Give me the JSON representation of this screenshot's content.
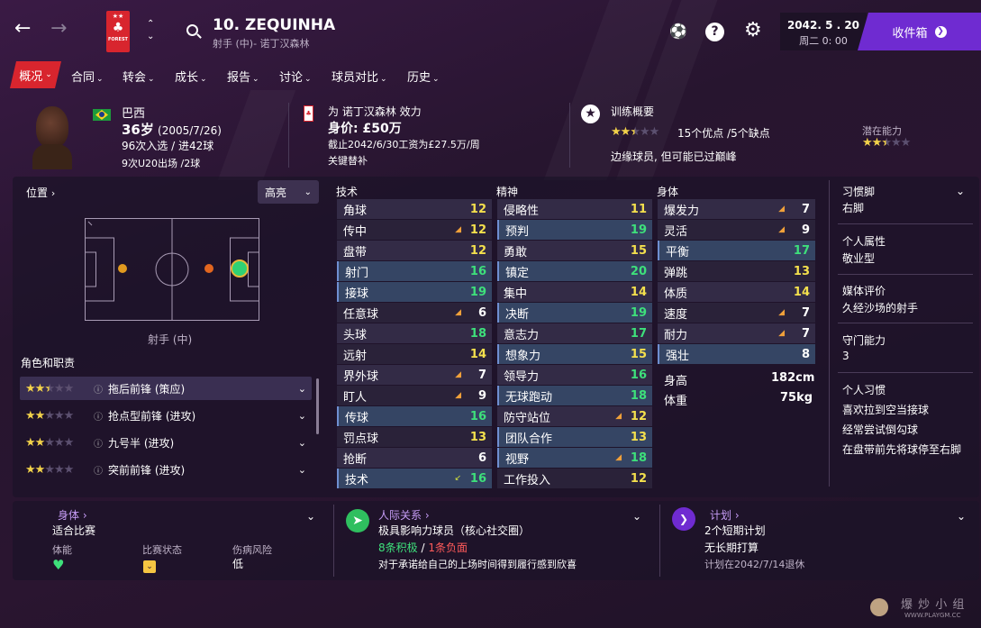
{
  "header": {
    "player_title": "10. ZEQUINHA",
    "player_subtitle": "射手 (中)- 诺丁汉森林",
    "club_badge_stars": "★★",
    "club_badge_text": "FOREST",
    "date": "2042. 5 . 20",
    "day_time": "周二 0: 00",
    "inbox_label": "收件箱"
  },
  "nav": {
    "tabs": [
      {
        "label": "概况",
        "active": true
      },
      {
        "label": "合同"
      },
      {
        "label": "转会"
      },
      {
        "label": "成长"
      },
      {
        "label": "报告"
      },
      {
        "label": "讨论"
      },
      {
        "label": "球员对比"
      },
      {
        "label": "历史"
      }
    ]
  },
  "info": {
    "nationality": "巴西",
    "age": "36岁",
    "dob": "(2005/7/26)",
    "caps": "96次入选 / 进42球",
    "u20": "9次U20出场 /2球",
    "plays_for": "为 诺丁汉森林 效力",
    "value": "身价: £50万",
    "contract": "截止2042/6/30工资为£27.5万/周",
    "squad_status": "关键替补",
    "training_title": "训练概要",
    "strengths": "15个优点 /5个缺点",
    "training_note": "边缘球员, 但可能已过巅峰",
    "potential_label": "潜在能力",
    "current_stars": 2.5,
    "potential_stars": 2.5
  },
  "position": {
    "title": "位置",
    "highlight_label": "高亮",
    "position_label": "射手 (中)",
    "roles_title": "角色和职责",
    "roles": [
      {
        "name": "拖后前锋 (策应)",
        "stars": 2.5
      },
      {
        "name": "抢点型前锋 (进攻)",
        "stars": 2
      },
      {
        "name": "九号半 (进攻)",
        "stars": 2
      },
      {
        "name": "突前前锋 (进攻)",
        "stars": 2
      }
    ]
  },
  "attributes": {
    "technical_title": "技术",
    "mental_title": "精神",
    "physical_title": "身体",
    "technical": [
      {
        "name": "角球",
        "value": "12",
        "arrow": ""
      },
      {
        "name": "传中",
        "value": "12",
        "arrow": "down"
      },
      {
        "name": "盘带",
        "value": "12",
        "arrow": ""
      },
      {
        "name": "射门",
        "value": "16",
        "arrow": "",
        "hl": true
      },
      {
        "name": "接球",
        "value": "19",
        "arrow": "",
        "hl": true
      },
      {
        "name": "任意球",
        "value": "6",
        "arrow": "down"
      },
      {
        "name": "头球",
        "value": "18",
        "arrow": ""
      },
      {
        "name": "远射",
        "value": "14",
        "arrow": ""
      },
      {
        "name": "界外球",
        "value": "7",
        "arrow": "down"
      },
      {
        "name": "盯人",
        "value": "9",
        "arrow": "down"
      },
      {
        "name": "传球",
        "value": "16",
        "arrow": "",
        "hl": true
      },
      {
        "name": "罚点球",
        "value": "13",
        "arrow": ""
      },
      {
        "name": "抢断",
        "value": "6",
        "arrow": ""
      },
      {
        "name": "技术",
        "value": "16",
        "arrow": "up",
        "hl": true
      }
    ],
    "mental": [
      {
        "name": "侵略性",
        "value": "11",
        "arrow": ""
      },
      {
        "name": "预判",
        "value": "19",
        "arrow": "",
        "hl": true
      },
      {
        "name": "勇敢",
        "value": "15",
        "arrow": ""
      },
      {
        "name": "镇定",
        "value": "20",
        "arrow": "",
        "hl": true
      },
      {
        "name": "集中",
        "value": "14",
        "arrow": ""
      },
      {
        "name": "决断",
        "value": "19",
        "arrow": "",
        "hl": true
      },
      {
        "name": "意志力",
        "value": "17",
        "arrow": ""
      },
      {
        "name": "想象力",
        "value": "15",
        "arrow": "",
        "hl": true
      },
      {
        "name": "领导力",
        "value": "16",
        "arrow": ""
      },
      {
        "name": "无球跑动",
        "value": "18",
        "arrow": "",
        "hl": true
      },
      {
        "name": "防守站位",
        "value": "12",
        "arrow": "down"
      },
      {
        "name": "团队合作",
        "value": "13",
        "arrow": "",
        "hl": true
      },
      {
        "name": "视野",
        "value": "18",
        "arrow": "down",
        "hl": true
      },
      {
        "name": "工作投入",
        "value": "12",
        "arrow": ""
      }
    ],
    "physical": [
      {
        "name": "爆发力",
        "value": "7",
        "arrow": "down"
      },
      {
        "name": "灵活",
        "value": "9",
        "arrow": "down"
      },
      {
        "name": "平衡",
        "value": "17",
        "arrow": "",
        "hl": true
      },
      {
        "name": "弹跳",
        "value": "13",
        "arrow": ""
      },
      {
        "name": "体质",
        "value": "14",
        "arrow": ""
      },
      {
        "name": "速度",
        "value": "7",
        "arrow": "down"
      },
      {
        "name": "耐力",
        "value": "7",
        "arrow": "down"
      },
      {
        "name": "强壮",
        "value": "8",
        "arrow": "",
        "hl": true
      }
    ],
    "height_label": "身高",
    "height_value": "182cm",
    "weight_label": "体重",
    "weight_value": "75kg"
  },
  "side": {
    "foot_title": "习惯脚",
    "foot_value": "右脚",
    "personality_title": "个人属性",
    "personality_value": "敬业型",
    "media_title": "媒体评价",
    "media_value": "久经沙场的射手",
    "defending_title": "守门能力",
    "defending_value": "3",
    "habits_title": "个人习惯",
    "habits": [
      "喜欢拉到空当接球",
      "经常尝试倒勾球",
      "在盘带前先将球停至右脚"
    ]
  },
  "bottom": {
    "body_title": "身体",
    "body_value": "适合比赛",
    "fitness_label": "体能",
    "match_label": "比赛状态",
    "injury_label": "伤病风险",
    "injury_value": "低",
    "social_title": "人际关系",
    "social_value": "极具影响力球员（核心社交圈）",
    "positive": "8条积极",
    "slash": "/",
    "negative": "1条负面",
    "social_note": "对于承诺给自己的上场时间得到履行感到欣喜",
    "plan_title": "计划",
    "plan_value": "2个短期计划",
    "plan_sub": "无长期打算",
    "plan_note": "计划在2042/7/14退休"
  },
  "watermark": {
    "text": "爆 炒 小 组",
    "url": "WWW.PLAYGM.CC"
  },
  "colors": {
    "accent_red": "#d8252e",
    "inbox_purple": "#6f2bd1",
    "attr_yellow": "#f4e04d",
    "attr_green": "#3ee07b",
    "arrow_orange": "#f0a03a",
    "positive_green": "#3ee07b",
    "negative_red": "#ff5a5a"
  }
}
